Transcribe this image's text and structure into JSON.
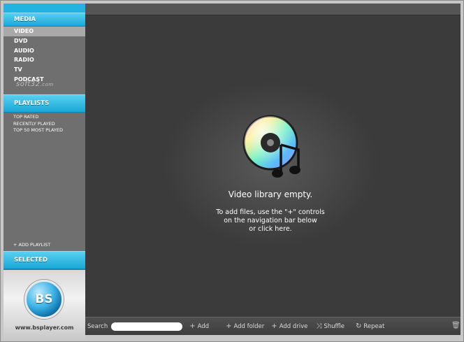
{
  "sidebar": {
    "media_header": "MEDIA",
    "nav_items": [
      {
        "label": "VIDEO",
        "active": true
      },
      {
        "label": "DVD",
        "active": false
      },
      {
        "label": "AUDIO",
        "active": false
      },
      {
        "label": "RADIO",
        "active": false
      },
      {
        "label": "TV",
        "active": false
      },
      {
        "label": "PODCAST",
        "active": false
      }
    ],
    "watermark": "soft32",
    "watermark_suffix": ".com",
    "playlists_header": "PLAYLISTS",
    "playlists": [
      "TOP RATED",
      "RECENTLY PLAYED",
      "TOP 50 MOST PLAYED"
    ],
    "add_playlist": "+ ADD PLAYLIST",
    "selected_header": "SELECTED",
    "logo_text": "BS",
    "logo_url": "www.bsplayer.com"
  },
  "main": {
    "empty_title": "Video library empty.",
    "empty_hint_line1": "To add files, use the \"+\" controls",
    "empty_hint_line2": "on the navigation bar below",
    "empty_hint_line3": "or click here."
  },
  "bottombar": {
    "search_label": "Search",
    "search_value": "",
    "add": "Add",
    "add_folder": "Add folder",
    "add_drive": "Add drive",
    "shuffle": "Shuffle",
    "repeat": "Repeat"
  },
  "colors": {
    "accent": "#1aa7d6",
    "sidebar_bg": "#6f6f6f",
    "main_bg": "#3b3b3b"
  },
  "icons": [
    "disc-music-icon",
    "plus-icon",
    "shuffle-icon",
    "repeat-icon",
    "trash-icon",
    "bsplayer-logo-icon"
  ]
}
